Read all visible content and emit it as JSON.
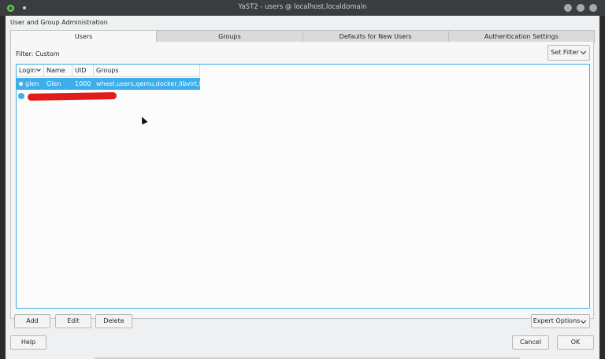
{
  "window": {
    "title": "YaST2 - users @ localhost.localdomain"
  },
  "header": {
    "section_title": "User and Group Administration"
  },
  "tabs": [
    {
      "label": "Users",
      "active": true
    },
    {
      "label": "Groups",
      "active": false
    },
    {
      "label": "Defaults for New Users",
      "active": false
    },
    {
      "label": "Authentication Settings",
      "active": false
    }
  ],
  "filter": {
    "label": "Filter: Custom",
    "set_filter_label": "Set Filter"
  },
  "table": {
    "columns": [
      "Login",
      "Name",
      "UID",
      "Groups"
    ],
    "rows": [
      {
        "login": "glen",
        "name": "Glen",
        "uid": "1000",
        "groups": "wheel,users,qemu,docker,libvirt,kvm",
        "selected": true
      }
    ]
  },
  "buttons": {
    "add": "Add",
    "edit": "Edit",
    "delete": "Delete",
    "expert_options": "Expert Options",
    "help": "Help",
    "cancel": "Cancel",
    "ok": "OK"
  },
  "colors": {
    "accent": "#3daee9",
    "redaction": "#e21b1b"
  }
}
